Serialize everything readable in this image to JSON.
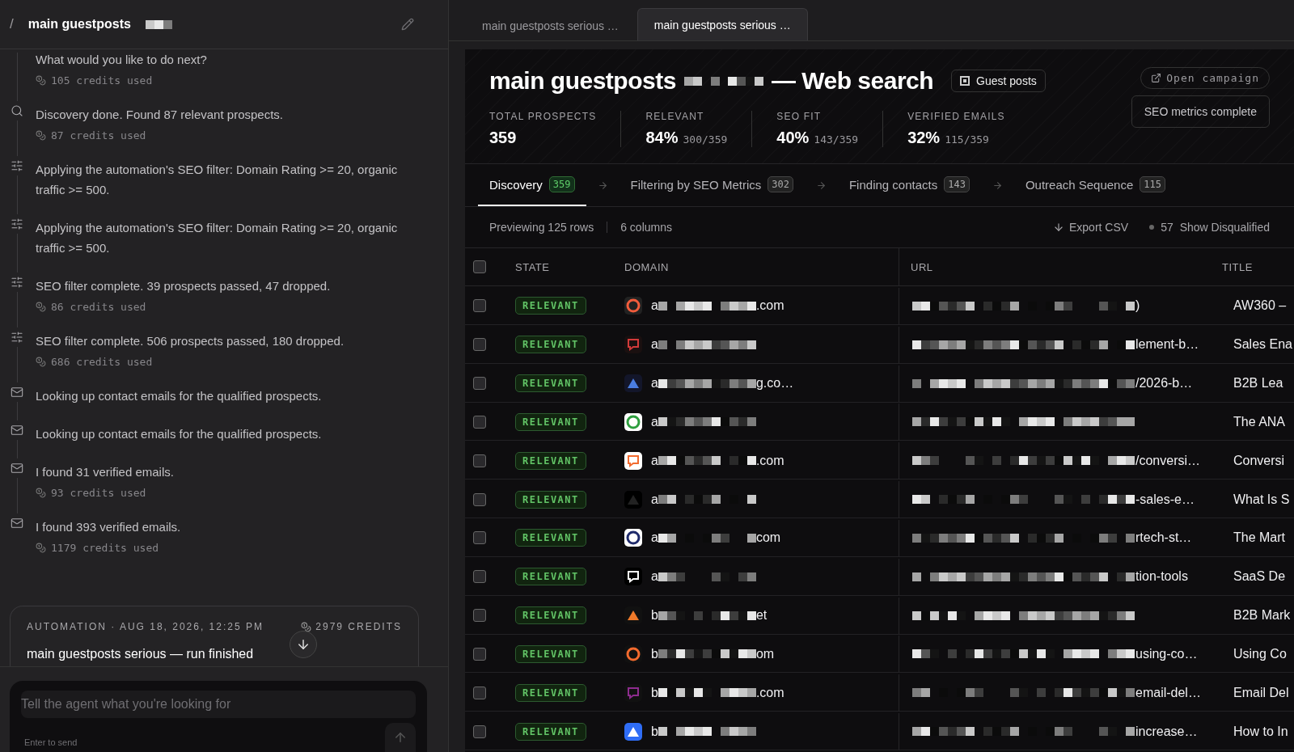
{
  "sidebar": {
    "slash": "/",
    "title": "main guestposts",
    "timeline": [
      {
        "kind": "message",
        "text": "What would you like to do next?",
        "credits": "105 credits used"
      },
      {
        "kind": "search",
        "text": "Discovery done. Found 87 relevant prospects.",
        "credits": "87 credits used"
      },
      {
        "kind": "filter",
        "text": "Applying the automation's SEO filter: Domain Rating >= 20, organic traffic >= 500."
      },
      {
        "kind": "filter",
        "text": "Applying the automation's SEO filter: Domain Rating >= 20, organic traffic >= 500."
      },
      {
        "kind": "filter",
        "text": "SEO filter complete. 39 prospects passed, 47 dropped.",
        "credits": "86 credits used"
      },
      {
        "kind": "filter",
        "text": "SEO filter complete. 506 prospects passed, 180 dropped.",
        "credits": "686 credits used"
      },
      {
        "kind": "email",
        "text": "Looking up contact emails for the qualified prospects."
      },
      {
        "kind": "email",
        "text": "Looking up contact emails for the qualified prospects."
      },
      {
        "kind": "email",
        "text": "I found 31 verified emails.",
        "credits": "93 credits used"
      },
      {
        "kind": "email",
        "text": "I found 393 verified emails.",
        "credits": "1179 credits used"
      }
    ],
    "run_card": {
      "meta": "AUTOMATION · AUG 18, 2026, 12:25 PM",
      "credits": "2979 CREDITS",
      "title": "main guestposts serious — run finished"
    },
    "composer": {
      "placeholder": "Tell the agent what you're looking for",
      "hint": "Enter to send"
    }
  },
  "tabs": [
    {
      "label": "main guestposts serious …",
      "selected": false
    },
    {
      "label": "main guestposts serious …",
      "selected": true
    }
  ],
  "campaign": {
    "title_start": "main guestposts",
    "title_end": "— Web search",
    "badge": "Guest posts",
    "open_button": "Open campaign",
    "status_button": "SEO metrics complete",
    "stats": [
      {
        "label": "TOTAL PROSPECTS",
        "value": "359"
      },
      {
        "label": "RELEVANT",
        "value": "84%",
        "fraction": "300/359"
      },
      {
        "label": "SEO FIT",
        "value": "40%",
        "fraction": "143/359"
      },
      {
        "label": "VERIFIED EMAILS",
        "value": "32%",
        "fraction": "115/359"
      }
    ],
    "steps": [
      {
        "label": "Discovery",
        "count": "359",
        "selected": true
      },
      {
        "label": "Filtering by SEO Metrics",
        "count": "302",
        "selected": false
      },
      {
        "label": "Finding contacts",
        "count": "143",
        "selected": false
      },
      {
        "label": "Outreach Sequence",
        "count": "115",
        "selected": false
      }
    ],
    "toolbar": {
      "rows": "Previewing 125 rows",
      "columns": "6 columns",
      "export": "Export CSV",
      "disqualified_count": "57",
      "disqualified": "Show Disqualified"
    }
  },
  "table": {
    "select_all": {
      "checked": false
    },
    "columns": [
      "STATE",
      "DOMAIN",
      "URL",
      "TITLE"
    ],
    "rows": [
      {
        "checked": false,
        "state": "RELEVANT",
        "domain_start": "a",
        "domain_end": ".com",
        "url_end": ")",
        "title": "AW360 –"
      },
      {
        "checked": false,
        "state": "RELEVANT",
        "domain_start": "a",
        "url_end": "lement-b…",
        "title": "Sales Ena"
      },
      {
        "checked": false,
        "state": "RELEVANT",
        "domain_start": "a",
        "domain_end": "g.co…",
        "url_end": "/2026-b…",
        "title": "B2B Lea"
      },
      {
        "checked": false,
        "state": "RELEVANT",
        "domain_start": "a",
        "title": "The ANA"
      },
      {
        "checked": false,
        "state": "RELEVANT",
        "domain_start": "a",
        "domain_end": ".com",
        "url_end": "/conversi…",
        "title": "Conversi"
      },
      {
        "checked": false,
        "state": "RELEVANT",
        "domain_start": "a",
        "url_end": "-sales-e…",
        "title": "What Is S"
      },
      {
        "checked": false,
        "state": "RELEVANT",
        "domain_start": "a",
        "domain_end": "com",
        "url_end": "rtech-st…",
        "title": "The Mart"
      },
      {
        "checked": false,
        "state": "RELEVANT",
        "domain_start": "a",
        "url_end": "tion-tools",
        "title": "SaaS De"
      },
      {
        "checked": false,
        "state": "RELEVANT",
        "domain_start": "b",
        "domain_end": "et",
        "title": "B2B Mark"
      },
      {
        "checked": false,
        "state": "RELEVANT",
        "domain_start": "b",
        "domain_end": "om",
        "url_end": "using-co…",
        "title": "Using Co"
      },
      {
        "checked": false,
        "state": "RELEVANT",
        "domain_start": "b",
        "domain_end": ".com",
        "url_end": "email-del…",
        "title": "Email Del"
      },
      {
        "checked": false,
        "state": "RELEVANT",
        "domain_start": "b",
        "url_end": "increase…",
        "title": "How to In"
      }
    ]
  }
}
